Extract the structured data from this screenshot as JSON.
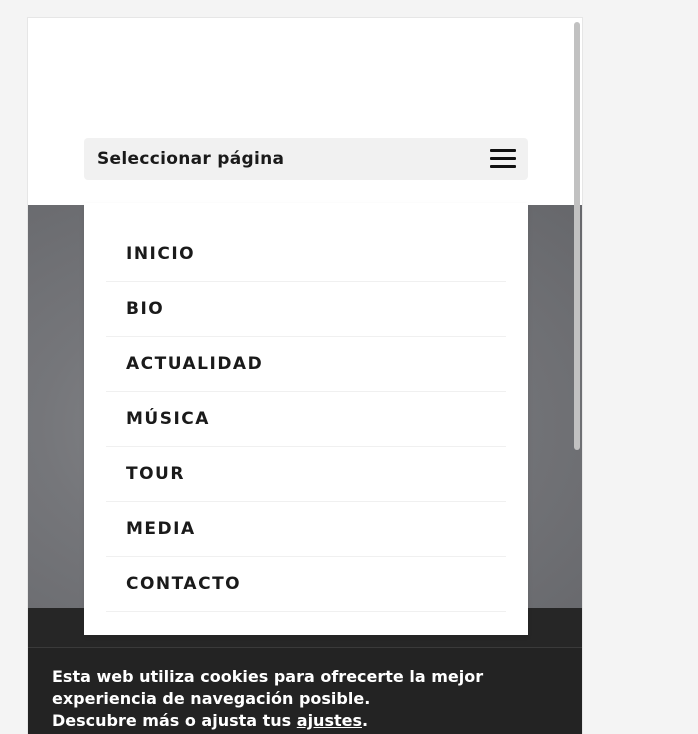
{
  "header": {
    "selector_label": "Seleccionar página"
  },
  "menu": {
    "items": [
      {
        "label": "INICIO"
      },
      {
        "label": "BIO"
      },
      {
        "label": "ACTUALIDAD"
      },
      {
        "label": "MÚSICA"
      },
      {
        "label": "TOUR"
      },
      {
        "label": "MEDIA"
      },
      {
        "label": "CONTACTO"
      }
    ]
  },
  "cookie_notice": {
    "line1": "Esta web utiliza cookies para ofrecerte la mejor experiencia de navegación posible.",
    "line2_prefix": "Descubre más o ajusta tus ",
    "link_label": "ajustes",
    "line2_suffix": "."
  },
  "icons": {
    "menu_toggle": "hamburger-icon"
  },
  "colors": {
    "hero_gray": "#75767a",
    "dark_band": "#262626",
    "cookie_bg": "#232323",
    "selector_bg": "#f1f1f1"
  }
}
